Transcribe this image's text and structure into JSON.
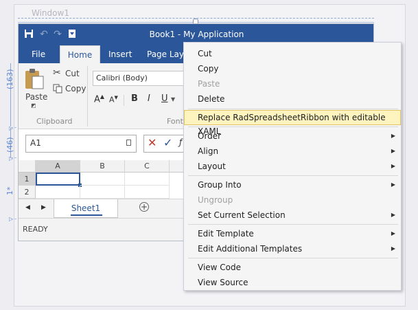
{
  "window": {
    "title": "Window1"
  },
  "app": {
    "title": "Book1 - My Application",
    "tabs": [
      "File",
      "Home",
      "Insert",
      "Page Layo"
    ],
    "clipboard": {
      "paste": "Paste",
      "cut": "Cut",
      "copy": "Copy",
      "group": "Clipboard"
    },
    "font": {
      "name": "Calibri (Body)",
      "group": "Font",
      "bold": "B",
      "italic": "I",
      "underline": "U",
      "grow": "A",
      "shrink": "A"
    },
    "namebox": "A1",
    "columns": [
      "A",
      "B",
      "C"
    ],
    "rows": [
      "1",
      "2"
    ],
    "sheet_tab": "Sheet1",
    "status": "READY"
  },
  "adorners": {
    "ribbon_height": "(163)",
    "formula_height": "(46)",
    "grid_star": "1*"
  },
  "context_menu": {
    "cut": "Cut",
    "copy": "Copy",
    "paste": "Paste",
    "delete": "Delete",
    "replace": "Replace RadSpreadsheetRibbon with editable XAML",
    "order": "Order",
    "align": "Align",
    "layout": "Layout",
    "group_into": "Group Into",
    "ungroup": "Ungroup",
    "set_current_selection": "Set Current Selection",
    "edit_template": "Edit Template",
    "edit_additional_templates": "Edit Additional Templates",
    "view_code": "View Code",
    "view_source": "View Source"
  },
  "colors": {
    "accent": "#2b579a",
    "highlight": "#fdf4bf",
    "adorner": "#5e86d0"
  }
}
